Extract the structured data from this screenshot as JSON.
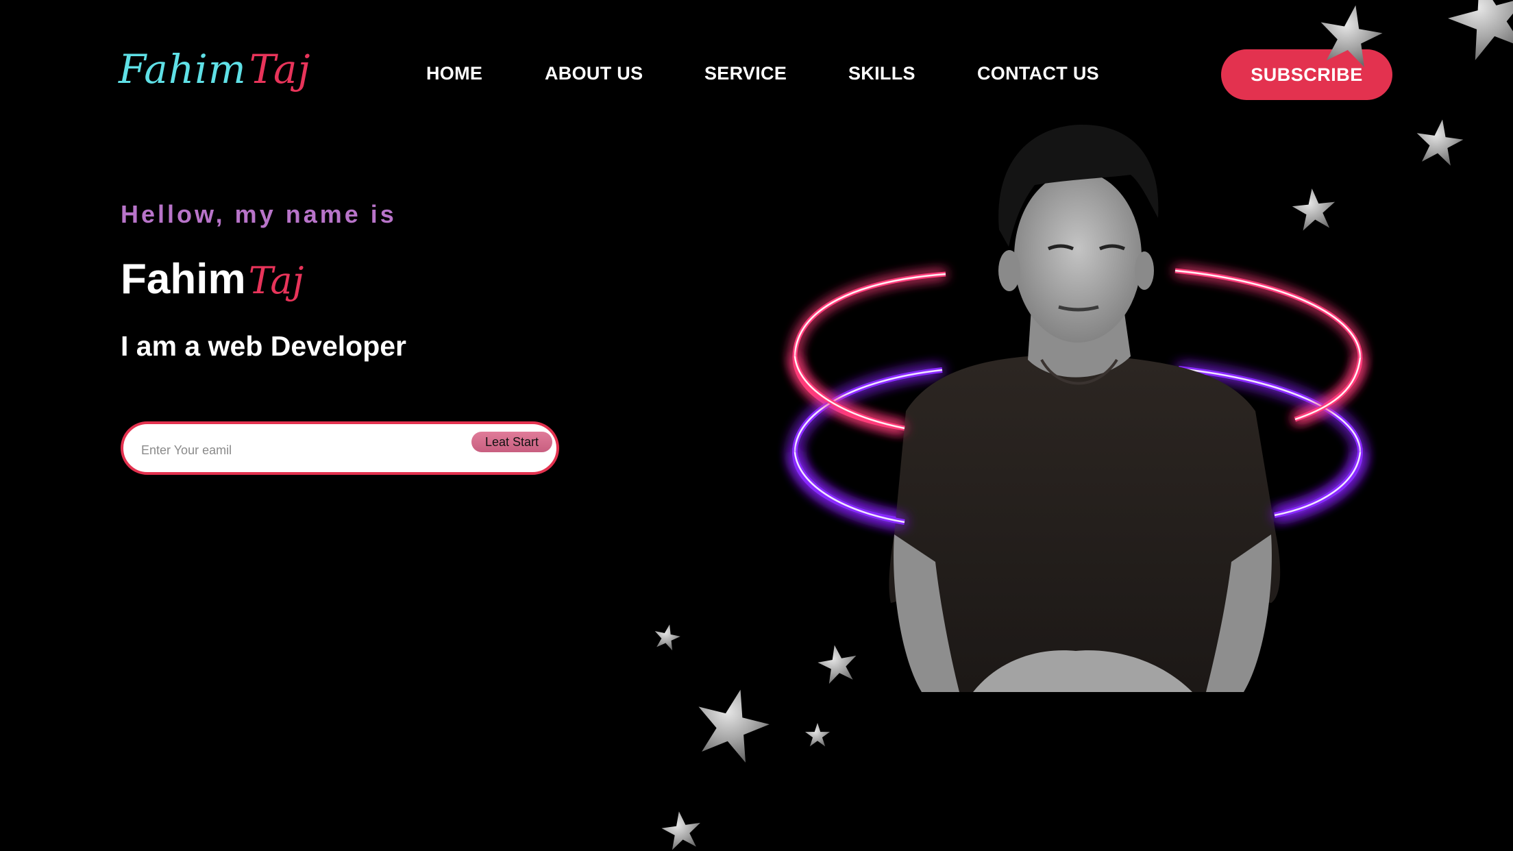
{
  "brand": {
    "logo_first": "Fahim",
    "logo_last": "Taj"
  },
  "nav": {
    "items": [
      {
        "label": "HOME"
      },
      {
        "label": "ABOUT US"
      },
      {
        "label": "SERVICE"
      },
      {
        "label": "SKILLS"
      },
      {
        "label": "CONTACT US"
      }
    ],
    "subscribe_label": "SUBSCRIBE"
  },
  "hero": {
    "greeting": "Hellow, my name is",
    "name_first": "Fahim",
    "name_last": "Taj",
    "role": "I am a web Developer",
    "email_placeholder": "Enter Your eamil",
    "start_label": "Leat Start"
  },
  "colors": {
    "background": "#000000",
    "accent": "#e3324f",
    "logo_cyan": "#5fe0e6",
    "greeting_purple": "#b874c9",
    "ring_top": "#ff3c7a",
    "ring_bottom": "#8a2bff"
  },
  "decor": {
    "stars": "glitter-star-icon",
    "portrait": "developer-portrait"
  }
}
